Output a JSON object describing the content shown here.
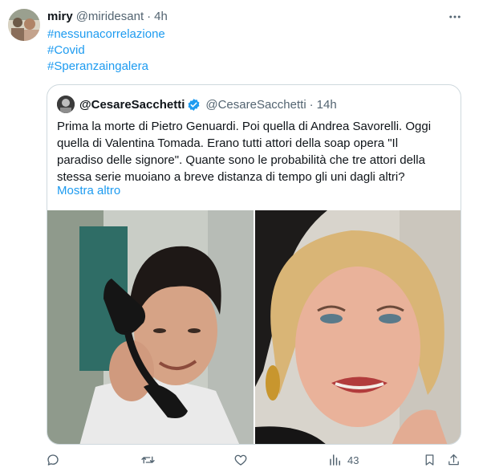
{
  "tweet": {
    "display_name": "miry",
    "handle": "@miridesant",
    "separator": "·",
    "time": "4h",
    "avatar_icon": "profile-photo",
    "hashtags": [
      "#nessunacorrelazione",
      "#Covid",
      "#Speranzaingalera"
    ]
  },
  "quoted": {
    "display_name": "@CesareSacchetti",
    "verified_icon": "verified-badge-icon",
    "handle": "@CesareSacchetti",
    "separator": "·",
    "time": "14h",
    "lines": [
      "Prima la morte di Pietro Genuardi. Poi quella di Andrea Savorelli. Oggi",
      "quella di Valentina Tomada. Erano tutti attori della soap opera \"Il",
      "paradiso delle signore\". Quante sono le probabilità che tre attori della",
      "stessa serie muoiano a breve distanza di tempo gli uni dagli altri?"
    ],
    "show_more": "Mostra altro",
    "media": [
      "photo-young-man-on-telephone",
      "photo-blonde-woman-smiling"
    ]
  },
  "actions": {
    "reply_icon": "reply-icon",
    "retweet_icon": "retweet-icon",
    "like_icon": "like-icon",
    "views_icon": "views-icon",
    "views_count": "43",
    "bookmark_icon": "bookmark-icon",
    "share_icon": "share-icon"
  },
  "colors": {
    "link": "#1d9bf0",
    "secondary_text": "#536471",
    "border": "#cfd9de"
  }
}
